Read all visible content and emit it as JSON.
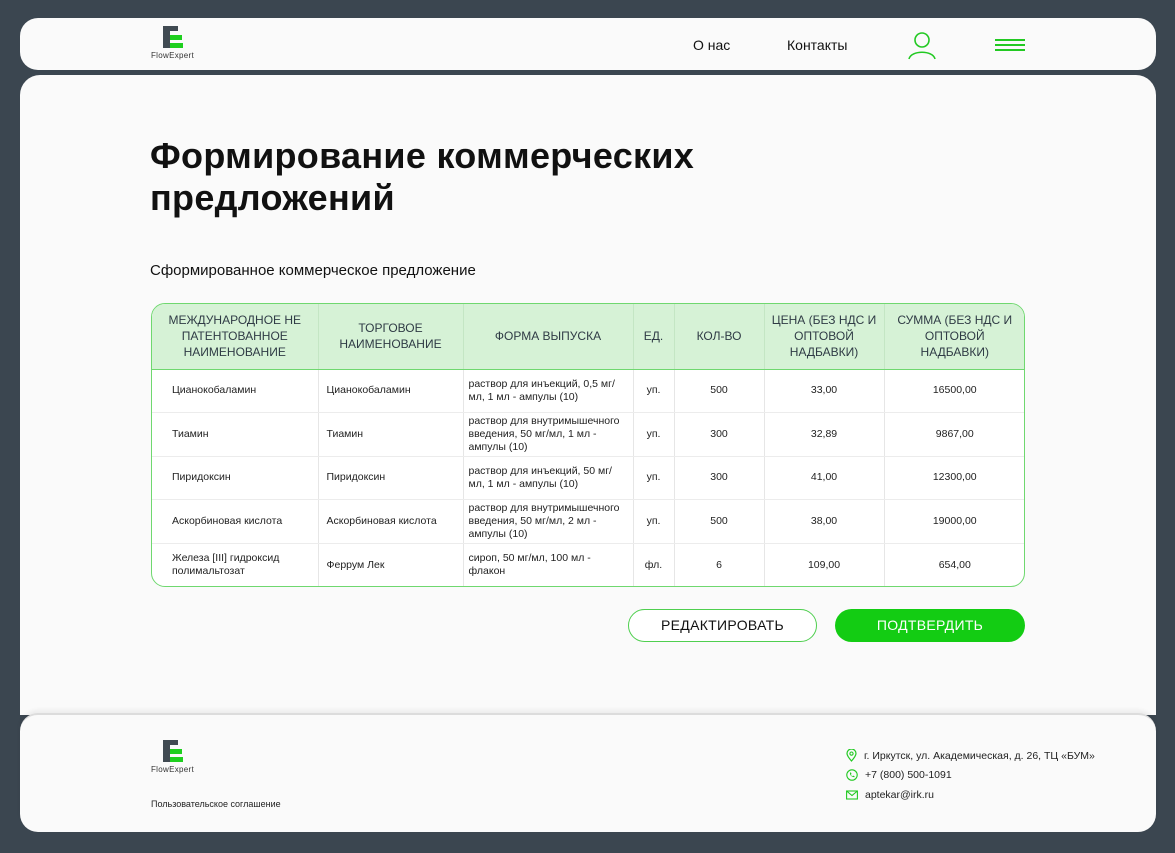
{
  "header": {
    "logo_text": "FlowExpert",
    "nav": {
      "about": "О нас",
      "contacts": "Контакты"
    }
  },
  "main": {
    "title": "Формирование коммерческих предложений",
    "subtitle": "Сформированное коммерческое предложение",
    "table": {
      "columns": [
        "Международное не патентованное наименование",
        "Торговое наименование",
        "Форма выпуска",
        "Ед.",
        "Кол-во",
        "Цена (без НДС и оптовой надбавки)",
        "Сумма (без НДС и оптовой надбавки)"
      ],
      "rows": [
        {
          "inn": "Цианокобаламин",
          "trade": "Цианокобаламин",
          "form": "раствор для инъекций, 0,5 мг/мл, 1 мл - ампулы (10)",
          "unit": "уп.",
          "qty": "500",
          "price": "33,00",
          "sum": "16500,00"
        },
        {
          "inn": "Тиамин",
          "trade": "Тиамин",
          "form": "раствор для внутримышечного введения, 50 мг/мл, 1 мл - ампулы (10)",
          "unit": "уп.",
          "qty": "300",
          "price": "32,89",
          "sum": "9867,00"
        },
        {
          "inn": "Пиридоксин",
          "trade": "Пиридоксин",
          "form": "раствор для инъекций, 50 мг/мл, 1 мл - ампулы (10)",
          "unit": "уп.",
          "qty": "300",
          "price": "41,00",
          "sum": "12300,00"
        },
        {
          "inn": "Аскорбиновая кислота",
          "trade": "Аскорбиновая кислота",
          "form": "раствор для внутримышечного введения, 50 мг/мл, 2  мл - ампулы (10)",
          "unit": "уп.",
          "qty": "500",
          "price": "38,00",
          "sum": "19000,00"
        },
        {
          "inn": "Железа [III] гидроксид полимальтозат",
          "trade": "Феррум Лек",
          "form": "сироп, 50 мг/мл, 100 мл - флакон",
          "unit": "фл.",
          "qty": "6",
          "price": "109,00",
          "sum": "654,00"
        }
      ]
    },
    "buttons": {
      "edit": "РЕДАКТИРОВАТЬ",
      "confirm": "ПОДТВЕРДИТЬ"
    }
  },
  "footer": {
    "logo_text": "FlowExpert",
    "agreement": "Пользовательское соглашение",
    "address": "г. Иркутск, ул. Академическая, д. 26, ТЦ «БУМ»",
    "phone": "+7 (800) 500-1091",
    "email": "aptekar@irk.ru"
  },
  "colors": {
    "accent": "#13cc13",
    "header_row": "#d6f2d6",
    "frame": "#3b4650"
  },
  "icons": [
    "user-icon",
    "hamburger-menu-icon",
    "location-pin-icon",
    "phone-icon",
    "mail-icon"
  ]
}
